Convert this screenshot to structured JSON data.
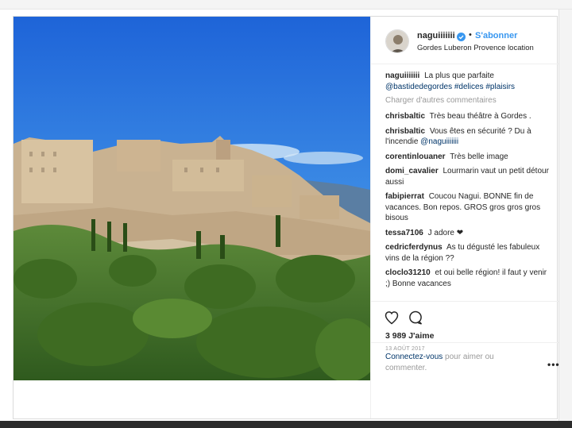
{
  "post": {
    "username": "naguiiiiiii",
    "follow_label": "S'abonner",
    "separator": "•",
    "location": "Gordes Luberon Provence location"
  },
  "caption": {
    "user": "naguiiiiiii",
    "text": "La plus que parfaite",
    "tags": "@bastidedegordes #delices #plaisirs"
  },
  "load_more": "Charger d'autres commentaires",
  "comments": [
    {
      "user": "chrisbaltic",
      "text": "Très beau théâtre à Gordes ."
    },
    {
      "user": "chrisbaltic",
      "text": "Vous êtes en sécurité ? Du à l'incendie",
      "mention": "@naguiiiiiii"
    },
    {
      "user": "corentinlouaner",
      "text": "Très belle image"
    },
    {
      "user": "domi_cavalier",
      "text": "Lourmarin vaut un petit détour aussi"
    },
    {
      "user": "fabipierrat",
      "text": "Coucou Nagui. BONNE fin de vacances. Bon repos. GROS gros gros gros bisous"
    },
    {
      "user": "tessa7106",
      "text": "J adore ❤"
    },
    {
      "user": "cedricferdynus",
      "text": "As tu dégusté les fabuleux vins de la région ??"
    },
    {
      "user": "cloclo31210",
      "text": "et oui belle région! il faut y venir ;) Bonne vacances"
    }
  ],
  "stats": {
    "likes": "3 989 J'aime",
    "date": "13 AOÛT 2017"
  },
  "login_prompt": {
    "link": "Connectez-vous",
    "rest": "pour aimer ou commenter."
  },
  "icons": {
    "like": "heart-icon",
    "comment": "comment-bubble-icon",
    "verified": "verified-badge-icon",
    "more": "more-options-icon"
  },
  "colors": {
    "link_blue": "#3897f0",
    "tag_blue": "#003569",
    "muted": "#999999"
  }
}
